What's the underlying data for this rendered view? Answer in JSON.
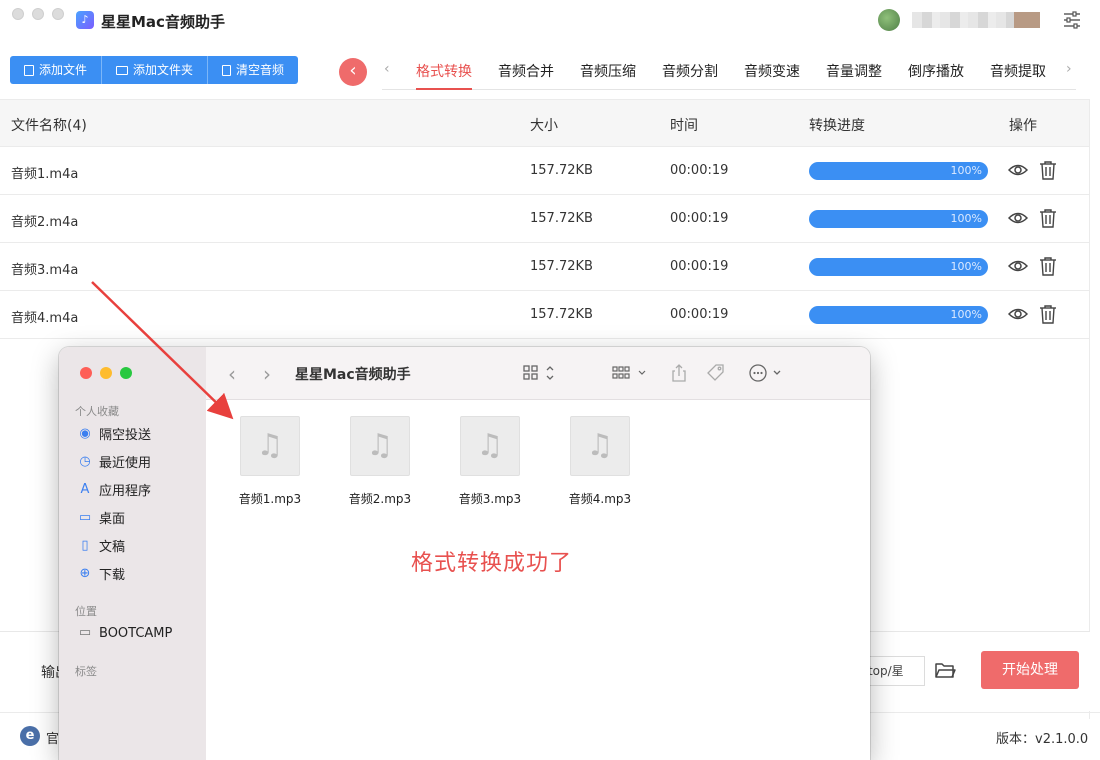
{
  "app": {
    "title": "星星Mac音频助手",
    "logo_glyph": "♪",
    "settings_icon": "sliders-icon"
  },
  "toolbar": {
    "add_file": "添加文件",
    "add_folder": "添加文件夹",
    "clear_audio": "清空音频"
  },
  "collapse_glyph": "‹",
  "tabs": {
    "prev": "‹",
    "next": "›",
    "items": [
      "格式转换",
      "音频合并",
      "音频压缩",
      "音频分割",
      "音频变速",
      "音量调整",
      "倒序播放",
      "音频提取"
    ],
    "active_index": 0
  },
  "table": {
    "headers": {
      "name": "文件名称(4)",
      "size": "大小",
      "time": "时间",
      "progress": "转换进度",
      "actions": "操作"
    },
    "rows": [
      {
        "name": "音频1.m4a",
        "size": "157.72KB",
        "time": "00:00:19",
        "progress": 1.0,
        "progress_label": "100%"
      },
      {
        "name": "音频2.m4a",
        "size": "157.72KB",
        "time": "00:00:19",
        "progress": 1.0,
        "progress_label": "100%"
      },
      {
        "name": "音频3.m4a",
        "size": "157.72KB",
        "time": "00:00:19",
        "progress": 1.0,
        "progress_label": "100%"
      },
      {
        "name": "音频4.m4a",
        "size": "157.72KB",
        "time": "00:00:19",
        "progress": 1.0,
        "progress_label": "100%"
      }
    ]
  },
  "bottom": {
    "output_label": "输出",
    "output_path": "ktop/星",
    "start_button": "开始处理"
  },
  "footer": {
    "logo_letter": "e",
    "link_text": "官",
    "version": "版本：v2.1.0.0"
  },
  "finder": {
    "title": "星星Mac音频助手",
    "sections": {
      "favorites": "个人收藏",
      "locations": "位置",
      "tags": "标签"
    },
    "favorites": [
      "隔空投送",
      "最近使用",
      "应用程序",
      "桌面",
      "文稿",
      "下载"
    ],
    "locations": [
      "BOOTCAMP"
    ],
    "files": [
      "音频1.mp3",
      "音频2.mp3",
      "音频3.mp3",
      "音频4.mp3"
    ],
    "file_glyph": "♫"
  },
  "annotation": {
    "message": "格式转换成功了",
    "color": "#e8514f"
  },
  "colors": {
    "primary_blue": "#3b8ff3",
    "accent_red": "#ef6b6b",
    "finder_close": "#fe5f57",
    "finder_min": "#febc2e",
    "finder_max": "#28c840"
  }
}
